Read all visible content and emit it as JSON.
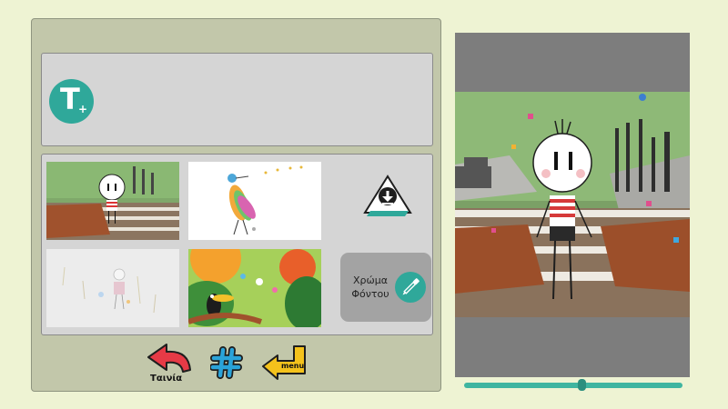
{
  "toolbar": {
    "add_text_glyph": "T",
    "add_text_plus": "+"
  },
  "backgrounds": {
    "color_button_label": "Χρώμα\nΦόντου"
  },
  "navigation": {
    "movie_label": "Ταινία",
    "menu_label": "menu"
  },
  "viewer": {
    "timeline_position": 0.54
  },
  "colors": {
    "accent": "#2fa89a",
    "page_bg": "#eef3d3",
    "panel_bg": "#c2c7aa"
  },
  "icons": [
    "add-text-icon",
    "upload-icon",
    "color-picker-icon",
    "back-arrow-icon",
    "hashtag-icon",
    "menu-arrow-icon"
  ]
}
